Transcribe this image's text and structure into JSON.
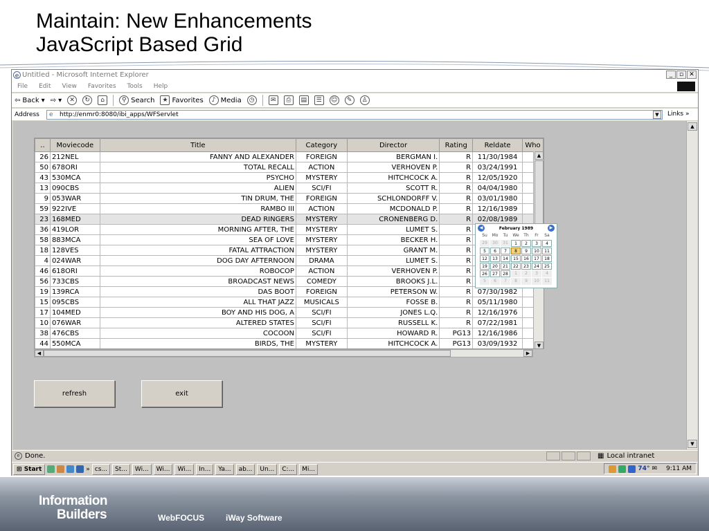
{
  "slide": {
    "title_line1": "Maintain: New Enhancements",
    "title_line2": "JavaScript Based Grid"
  },
  "browser": {
    "window_title": "Untitled - Microsoft Internet Explorer",
    "menu": [
      "File",
      "Edit",
      "View",
      "Favorites",
      "Tools",
      "Help"
    ],
    "toolbar": {
      "back": "Back",
      "search": "Search",
      "favorites": "Favorites",
      "media": "Media"
    },
    "address_label": "Address",
    "address_url": "http://enmr0:8080/ibi_apps/WFServlet",
    "links_label": "Links",
    "status_text": "Done.",
    "zone_text": "Local intranet"
  },
  "grid": {
    "columns": [
      "..",
      "Moviecode",
      "Title",
      "Category",
      "Director",
      "Rating",
      "Reldate",
      "Who"
    ],
    "rows": [
      [
        "26",
        "212NEL",
        "FANNY AND ALEXANDER",
        "FOREIGN",
        "BERGMAN I.",
        "R",
        "11/30/1984"
      ],
      [
        "50",
        "678ORI",
        "TOTAL RECALL",
        "ACTION",
        "VERHOVEN P.",
        "R",
        "03/24/1991"
      ],
      [
        "43",
        "530MCA",
        "PSYCHO",
        "MYSTERY",
        "HITCHCOCK A.",
        "R",
        "12/05/1920"
      ],
      [
        "13",
        "090CBS",
        "ALIEN",
        "SCI/FI",
        "SCOTT R.",
        "R",
        "04/04/1980"
      ],
      [
        "9",
        "053WAR",
        "TIN DRUM, THE",
        "FOREIGN",
        "SCHLONDORFF V.",
        "R",
        "03/01/1980"
      ],
      [
        "59",
        "922IVE",
        "RAMBO III",
        "ACTION",
        "MCDONALD P.",
        "R",
        "12/16/1989"
      ],
      [
        "23",
        "168MED",
        "DEAD RINGERS",
        "MYSTERY",
        "CRONENBERG D.",
        "R",
        "02/08/1989"
      ],
      [
        "36",
        "419LOR",
        "MORNING AFTER, THE",
        "MYSTERY",
        "LUMET S.",
        "R",
        ""
      ],
      [
        "58",
        "883MCA",
        "SEA OF LOVE",
        "MYSTERY",
        "BECKER H.",
        "R",
        ""
      ],
      [
        "18",
        "128VES",
        "FATAL ATTRACTION",
        "MYSTERY",
        "GRANT M.",
        "R",
        ""
      ],
      [
        "4",
        "024WAR",
        "DOG DAY AFTERNOON",
        "DRAMA",
        "LUMET S.",
        "R",
        ""
      ],
      [
        "46",
        "618ORI",
        "ROBOCOP",
        "ACTION",
        "VERHOVEN P.",
        "R",
        ""
      ],
      [
        "56",
        "733CBS",
        "BROADCAST NEWS",
        "COMEDY",
        "BROOKS J.L.",
        "R",
        ""
      ],
      [
        "19",
        "139RCA",
        "DAS BOOT",
        "FOREIGN",
        "PETERSON W.",
        "R",
        "07/30/1982"
      ],
      [
        "15",
        "095CBS",
        "ALL THAT JAZZ",
        "MUSICALS",
        "FOSSE B.",
        "R",
        "05/11/1980"
      ],
      [
        "17",
        "104MED",
        "BOY AND HIS DOG, A",
        "SCI/FI",
        "JONES L.Q.",
        "R",
        "12/16/1976"
      ],
      [
        "10",
        "076WAR",
        "ALTERED STATES",
        "SCI/FI",
        "RUSSELL K.",
        "R",
        "07/22/1981"
      ],
      [
        "38",
        "476CBS",
        "COCOON",
        "SCI/FI",
        "HOWARD R.",
        "PG13",
        "12/16/1986"
      ],
      [
        "44",
        "550MCA",
        "BIRDS, THE",
        "MYSTERY",
        "HITCHCOCK A.",
        "PG13",
        "03/09/1932"
      ]
    ],
    "selected_row": 6
  },
  "calendar": {
    "month_label": "February 1989",
    "weekdays": [
      "Su",
      "Mo",
      "Tu",
      "We",
      "Th",
      "Fr",
      "Sa"
    ],
    "days": [
      [
        "29",
        "30",
        "31",
        "1",
        "2",
        "3",
        "4"
      ],
      [
        "5",
        "6",
        "7",
        "8",
        "9",
        "10",
        "11"
      ],
      [
        "12",
        "13",
        "14",
        "15",
        "16",
        "17",
        "18"
      ],
      [
        "19",
        "20",
        "21",
        "22",
        "23",
        "24",
        "25"
      ],
      [
        "26",
        "27",
        "28",
        "1",
        "2",
        "3",
        "4"
      ],
      [
        "5",
        "6",
        "7",
        "8",
        "9",
        "10",
        "11"
      ]
    ],
    "selected_day": "8"
  },
  "buttons": {
    "refresh": "refresh",
    "exit": "exit"
  },
  "taskbar": {
    "start": "Start",
    "tasks": [
      "cs...",
      "St...",
      "Wi...",
      "Wi...",
      "Wi...",
      "In...",
      "Ya...",
      "ab...",
      "Un...",
      "C:...",
      "Mi..."
    ],
    "tray_temp": "74°",
    "clock": "9:11 AM"
  },
  "footer": {
    "logo_line1": "Information",
    "logo_line2": "Builders",
    "link1": "WebFOCUS",
    "link2": "iWay Software"
  },
  "colors": {
    "ie_chrome": "#d4d0c8",
    "content_bg": "#c0c0c0",
    "calendar_accent": "#3a6fc4",
    "footer_dark": "#596372"
  }
}
